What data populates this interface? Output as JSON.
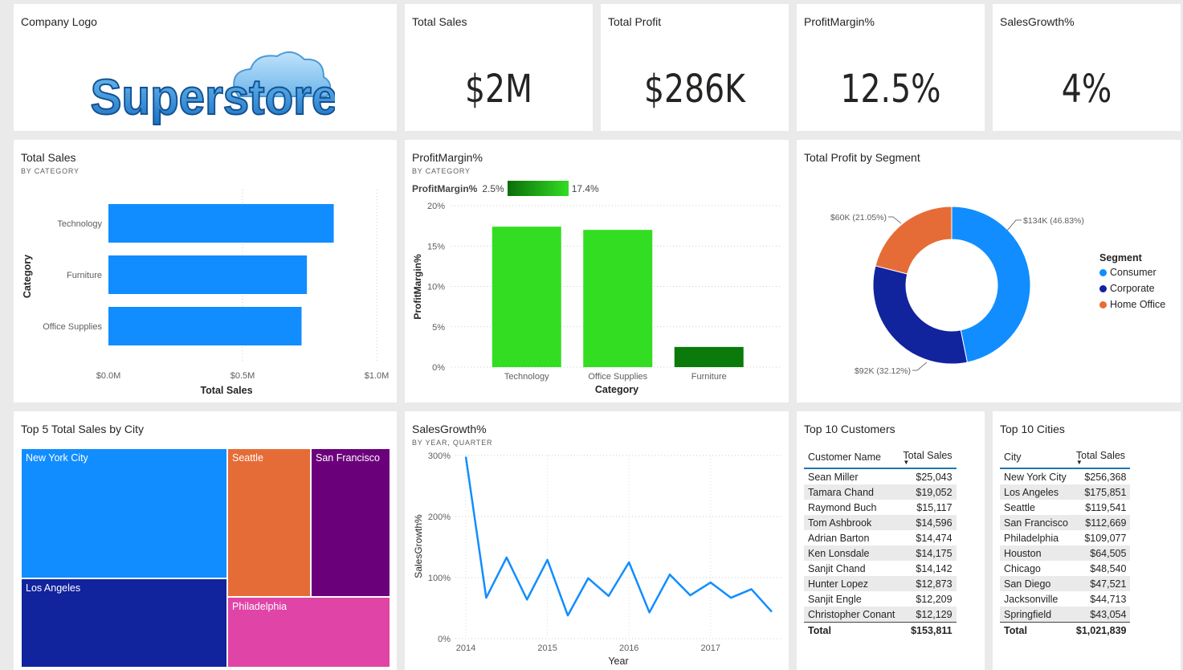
{
  "logo_card": {
    "title": "Company Logo",
    "logo_text": "Superstore"
  },
  "kpis": [
    {
      "title": "Total Sales",
      "value": "$2M"
    },
    {
      "title": "Total Profit",
      "value": "$286K"
    },
    {
      "title": "ProfitMargin%",
      "value": "12.5%"
    },
    {
      "title": "SalesGrowth%",
      "value": "4%"
    }
  ],
  "colors": {
    "blue": "#118dff",
    "green": "#33dd22",
    "dark_green": "#0a7a0a",
    "navy": "#12239e",
    "orange": "#e66c37",
    "purple": "#6b007b",
    "pink": "#e044a7"
  },
  "sales_by_category": {
    "title": "Total Sales",
    "subtitle": "BY CATEGORY",
    "chart_data": {
      "type": "bar",
      "orientation": "horizontal",
      "categories": [
        "Technology",
        "Furniture",
        "Office Supplies"
      ],
      "values": [
        0.84,
        0.74,
        0.72
      ],
      "xlabel": "Total Sales",
      "ylabel": "Category",
      "xlim": [
        0,
        1.0
      ],
      "ticks": [
        "$0.0M",
        "$0.5M",
        "$1.0M"
      ]
    }
  },
  "margin_by_category": {
    "title": "ProfitMargin%",
    "subtitle": "BY CATEGORY",
    "legend_label": "ProfitMargin%",
    "legend_min": "2.5%",
    "legend_max": "17.4%",
    "chart_data": {
      "type": "bar",
      "categories": [
        "Technology",
        "Office Supplies",
        "Furniture"
      ],
      "values": [
        17.4,
        17.0,
        2.5
      ],
      "xlabel": "Category",
      "ylabel": "ProfitMargin%",
      "ylim": [
        0,
        20
      ],
      "ticks": [
        "0%",
        "5%",
        "10%",
        "15%",
        "20%"
      ]
    }
  },
  "profit_by_segment": {
    "title": "Total Profit by Segment",
    "legend_title": "Segment",
    "chart_data": {
      "type": "pie",
      "labels": [
        "Consumer",
        "Corporate",
        "Home Office"
      ],
      "values": [
        46.83,
        32.12,
        21.05
      ],
      "data_labels": [
        "$134K (46.83%)",
        "$92K (32.12%)",
        "$60K (21.05%)"
      ]
    }
  },
  "top_cities_treemap": {
    "title": "Top 5 Total Sales by City",
    "chart_data": {
      "type": "treemap",
      "labels": [
        "New York City",
        "Los Angeles",
        "Seattle",
        "San Francisco",
        "Philadelphia"
      ],
      "values": [
        256368,
        175851,
        119541,
        112669,
        109077
      ]
    }
  },
  "sales_growth": {
    "title": "SalesGrowth%",
    "subtitle": "BY YEAR, QUARTER",
    "chart_data": {
      "type": "line",
      "x": [
        "2014 Q1",
        "2014 Q2",
        "2014 Q3",
        "2014 Q4",
        "2015 Q1",
        "2015 Q2",
        "2015 Q3",
        "2015 Q4",
        "2016 Q1",
        "2016 Q2",
        "2016 Q3",
        "2016 Q4",
        "2017 Q1",
        "2017 Q2",
        "2017 Q3",
        "2017 Q4"
      ],
      "values": [
        298,
        67,
        133,
        64,
        129,
        38,
        99,
        70,
        125,
        43,
        105,
        71,
        92,
        67,
        81,
        44
      ],
      "xlabel": "Year",
      "ylabel": "SalesGrowth%",
      "ylim": [
        0,
        300
      ],
      "yticks": [
        "0%",
        "100%",
        "200%",
        "300%"
      ],
      "xticks": [
        "2014",
        "2015",
        "2016",
        "2017"
      ]
    }
  },
  "top_customers": {
    "title": "Top 10 Customers",
    "columns": [
      "Customer Name",
      "Total Sales"
    ],
    "rows": [
      [
        "Sean Miller",
        "$25,043"
      ],
      [
        "Tamara Chand",
        "$19,052"
      ],
      [
        "Raymond Buch",
        "$15,117"
      ],
      [
        "Tom Ashbrook",
        "$14,596"
      ],
      [
        "Adrian Barton",
        "$14,474"
      ],
      [
        "Ken Lonsdale",
        "$14,175"
      ],
      [
        "Sanjit Chand",
        "$14,142"
      ],
      [
        "Hunter Lopez",
        "$12,873"
      ],
      [
        "Sanjit Engle",
        "$12,209"
      ],
      [
        "Christopher Conant",
        "$12,129"
      ]
    ],
    "total_label": "Total",
    "total_value": "$153,811"
  },
  "top_cities": {
    "title": "Top 10 Cities",
    "columns": [
      "City",
      "Total Sales"
    ],
    "rows": [
      [
        "New York City",
        "$256,368"
      ],
      [
        "Los Angeles",
        "$175,851"
      ],
      [
        "Seattle",
        "$119,541"
      ],
      [
        "San Francisco",
        "$112,669"
      ],
      [
        "Philadelphia",
        "$109,077"
      ],
      [
        "Houston",
        "$64,505"
      ],
      [
        "Chicago",
        "$48,540"
      ],
      [
        "San Diego",
        "$47,521"
      ],
      [
        "Jacksonville",
        "$44,713"
      ],
      [
        "Springfield",
        "$43,054"
      ]
    ],
    "total_label": "Total",
    "total_value": "$1,021,839"
  }
}
